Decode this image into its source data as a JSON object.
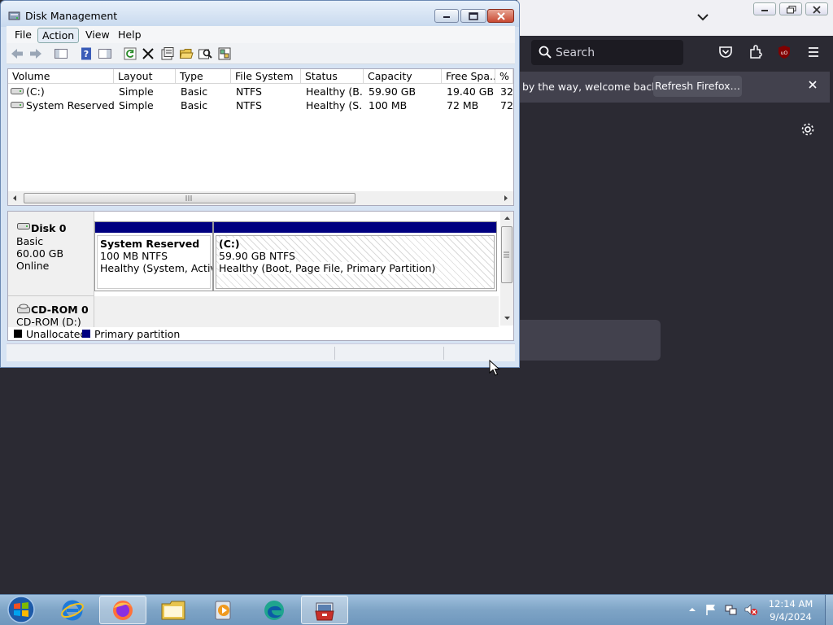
{
  "firefox": {
    "search_placeholder": "Search",
    "notification_text": "by the way, welcome back!",
    "refresh_button": "Refresh Firefox…"
  },
  "disk_mgmt": {
    "title": "Disk Management",
    "menu": [
      "File",
      "Action",
      "View",
      "Help"
    ],
    "columns": [
      "Volume",
      "Layout",
      "Type",
      "File System",
      "Status",
      "Capacity",
      "Free Spa...",
      "% F"
    ],
    "rows": [
      {
        "volume": "(C:)",
        "layout": "Simple",
        "type": "Basic",
        "fs": "NTFS",
        "status": "Healthy (B...",
        "capacity": "59.90 GB",
        "free": "19.40 GB",
        "pct": "32"
      },
      {
        "volume": "System Reserved",
        "layout": "Simple",
        "type": "Basic",
        "fs": "NTFS",
        "status": "Healthy (S...",
        "capacity": "100 MB",
        "free": "72 MB",
        "pct": "72"
      }
    ],
    "disk0": {
      "name": "Disk 0",
      "kind": "Basic",
      "size": "60.00 GB",
      "state": "Online"
    },
    "cdrom": {
      "name": "CD-ROM 0",
      "drive": "CD-ROM (D:)"
    },
    "partitions": [
      {
        "name": "System Reserved",
        "size_fs": "100 MB NTFS",
        "health": "Healthy (System, Active,"
      },
      {
        "name": "(C:)",
        "size_fs": "59.90 GB NTFS",
        "health": "Healthy (Boot, Page File, Primary Partition)"
      }
    ],
    "legend": [
      {
        "label": "Unallocated",
        "color": "#000000"
      },
      {
        "label": "Primary partition",
        "color": "#000080"
      }
    ]
  },
  "taskbar": {
    "pinned": [
      "windows-start",
      "internet-explorer",
      "firefox",
      "file-explorer",
      "media-player",
      "edge",
      "computer-management"
    ],
    "clock_time": "12:14 AM",
    "clock_date": "9/4/2024"
  }
}
